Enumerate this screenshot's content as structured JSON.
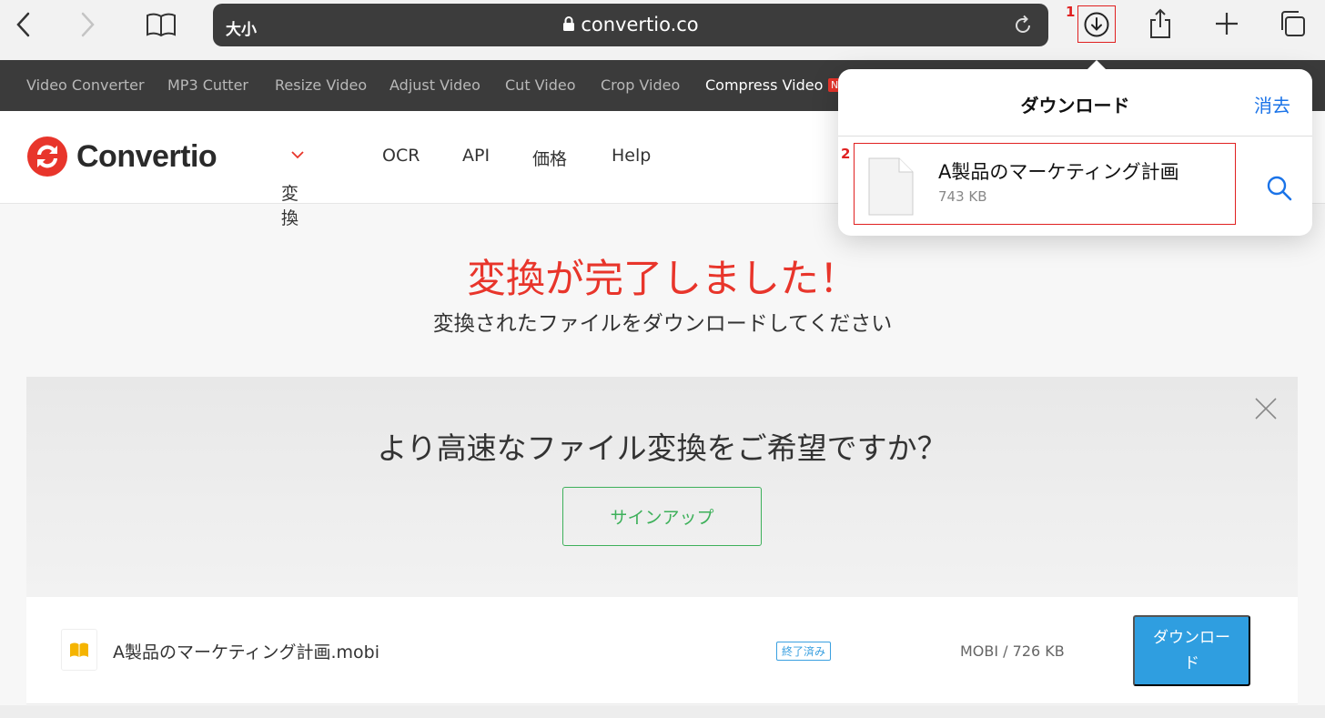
{
  "browser": {
    "text_size_label": "大小",
    "url": "convertio.co",
    "annotation_1": "1",
    "annotation_2": "2"
  },
  "site_nav": {
    "links": [
      "Video Converter",
      "MP3 Cutter",
      "Resize Video",
      "Adjust Video",
      "Cut Video",
      "Crop Video",
      "Compress Video"
    ],
    "new_badge": "N"
  },
  "header": {
    "brand": "Convertio",
    "menu": [
      "変換",
      "OCR",
      "API",
      "価格",
      "Help"
    ]
  },
  "hero": {
    "title": "変換が完了しました！",
    "subtitle": "変換されたファイルをダウンロードしてください"
  },
  "promo": {
    "question": "より高速なファイル変換をご希望ですか？",
    "signup_label": "サインアップ"
  },
  "file": {
    "name": "A製品のマーケティング計画.mobi",
    "status": "終了済み",
    "meta": "MOBI / 726 KB",
    "download_label": "ダウンロード"
  },
  "downloads_popover": {
    "title": "ダウンロード",
    "clear_label": "消去",
    "item_name": "A製品のマーケティング計画",
    "item_size": "743 KB"
  },
  "colors": {
    "accent_red": "#e8352b",
    "signup_green": "#3db05a",
    "download_blue": "#2f9ee0",
    "ios_blue": "#1a73e8",
    "annotation_red": "#e02020"
  }
}
